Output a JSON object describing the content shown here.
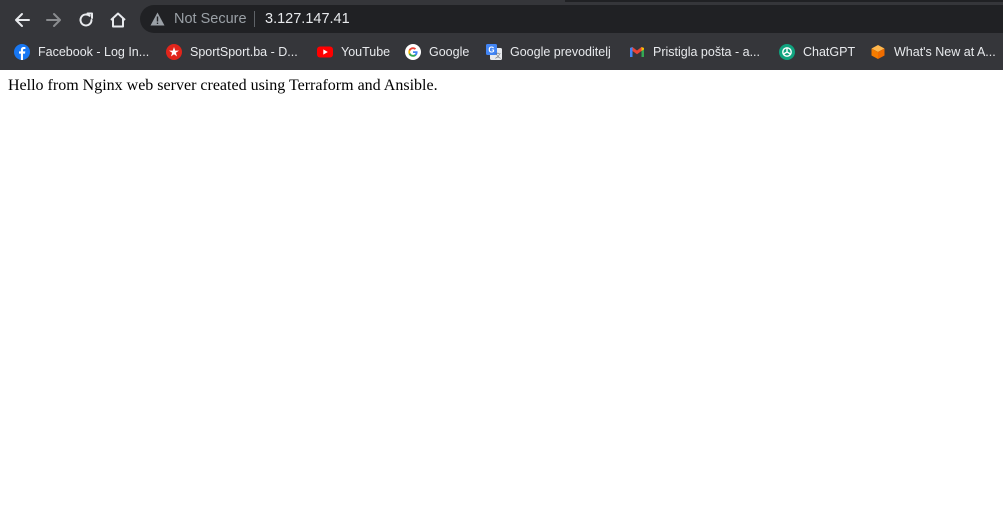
{
  "colors": {
    "toolbar_bg": "#35363a",
    "omnibox_bg": "#202124",
    "toolbar_text": "#e8eaed",
    "muted_text": "#9aa0a6",
    "page_bg": "#ffffff",
    "page_text": "#000000"
  },
  "toolbar": {
    "back_icon": "arrow-left-icon",
    "forward_icon": "arrow-right-icon",
    "reload_icon": "reload-icon",
    "home_icon": "home-icon"
  },
  "omnibox": {
    "security_icon": "warning-triangle-icon",
    "security_label": "Not Secure",
    "url": "3.127.147.41"
  },
  "bookmarks": [
    {
      "label": "Facebook - Log In...",
      "icon": "facebook-icon"
    },
    {
      "label": "SportSport.ba - D...",
      "icon": "sportsport-icon"
    },
    {
      "label": "YouTube",
      "icon": "youtube-icon"
    },
    {
      "label": "Google",
      "icon": "google-icon"
    },
    {
      "label": "Google prevoditelj",
      "icon": "google-translate-icon"
    },
    {
      "label": "Pristigla pošta - a...",
      "icon": "gmail-icon"
    },
    {
      "label": "ChatGPT",
      "icon": "chatgpt-icon"
    },
    {
      "label": "What's New at A...",
      "icon": "aws-cube-icon"
    }
  ],
  "page": {
    "text": "Hello from Nginx web server created using Terraform and Ansible."
  }
}
